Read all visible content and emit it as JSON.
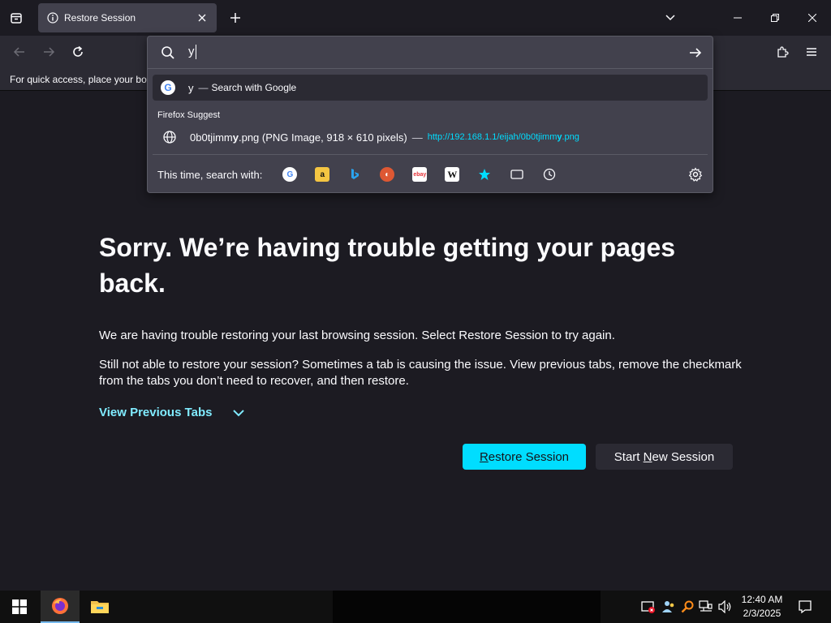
{
  "tabbar": {
    "tab": {
      "label": "Restore Session",
      "icon": "info-icon",
      "close_icon": "close-icon"
    },
    "new_tab_icon": "plus-icon",
    "list_all_tabs_icon": "chevron-down-icon",
    "window_controls": [
      "minimize-icon",
      "restore-icon",
      "close-icon"
    ]
  },
  "navbar": {
    "back_icon": "arrow-left-icon",
    "forward_icon": "arrow-right-icon",
    "reload_icon": "reload-icon",
    "extensions_icon": "puzzle-icon",
    "menu_icon": "hamburger-menu-icon"
  },
  "bookmarks": {
    "text": "For quick access, place your boo"
  },
  "urlbar": {
    "value": "y",
    "search_icon": "search-icon",
    "go_icon": "arrow-right-icon",
    "google_suggestion": {
      "query": "y",
      "dash": "—",
      "action": "Search with Google"
    },
    "suggest_heading": "Firefox Suggest",
    "history_suggestion": {
      "title_prefix": "0b0tjimm",
      "title_bold": "y",
      "title_suffix": ".png (PNG Image, 918 × 610 pixels)",
      "dash": "—",
      "url_prefix": "http://192.168.1.1/eijah/0b0tjimm",
      "url_bold": "y",
      "url_suffix": ".png"
    },
    "engines_label": "This time, search with:",
    "engines": [
      "google",
      "amazon",
      "bing",
      "duckduckgo",
      "ebay",
      "wikipedia",
      "bookmarks",
      "tabs",
      "history"
    ]
  },
  "page": {
    "title": "Sorry. We’re having trouble getting your pages back.",
    "paragraph1": "We are having trouble restoring your last browsing session. Select Restore Session to try again.",
    "paragraph2": "Still not able to restore your session? Sometimes a tab is causing the issue. View previous tabs, remove the checkmark from the tabs you don’t need to recover, and then restore.",
    "view_previous_label": "View Previous Tabs",
    "restore_label_first": "R",
    "restore_label_rest": "estore Session",
    "new_session_label_pre": "Start ",
    "new_session_label_key": "N",
    "new_session_label_post": "ew Session"
  },
  "taskbar": {
    "time": "12:40 AM",
    "date": "2/3/2025",
    "apps": [
      "windows-start-icon",
      "firefox-icon",
      "file-explorer-icon"
    ]
  },
  "colors": {
    "accent": "#00ddff",
    "link": "#80ebff",
    "bg": "#1c1b22",
    "panel": "#42414d"
  }
}
